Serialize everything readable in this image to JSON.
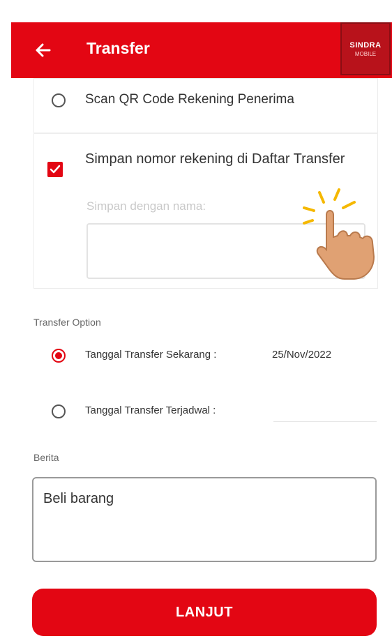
{
  "header": {
    "title": "Transfer",
    "logo_top": "SINDRA",
    "logo_bottom": "MOBILE"
  },
  "options": {
    "scan_qr_label": "Scan QR Code Rekening Penerima",
    "save_account_label": "Simpan nomor rekening di Daftar Transfer",
    "save_account_checked": true,
    "save_name_hint": "Simpan dengan nama:",
    "save_name_value": ""
  },
  "transfer_option": {
    "section_label": "Transfer Option",
    "now_label": "Tanggal Transfer Sekarang :",
    "now_date": "25/Nov/2022",
    "now_selected": true,
    "scheduled_label": "Tanggal Transfer Terjadwal :",
    "scheduled_selected": false
  },
  "berita": {
    "label": "Berita",
    "value": "Beli barang"
  },
  "actions": {
    "continue_label": "LANJUT"
  },
  "colors": {
    "primary": "#e30613",
    "logo_bg": "#b8121b"
  },
  "icons": {
    "back": "arrow-left-icon",
    "tap_hint": "tap-hand-icon"
  }
}
